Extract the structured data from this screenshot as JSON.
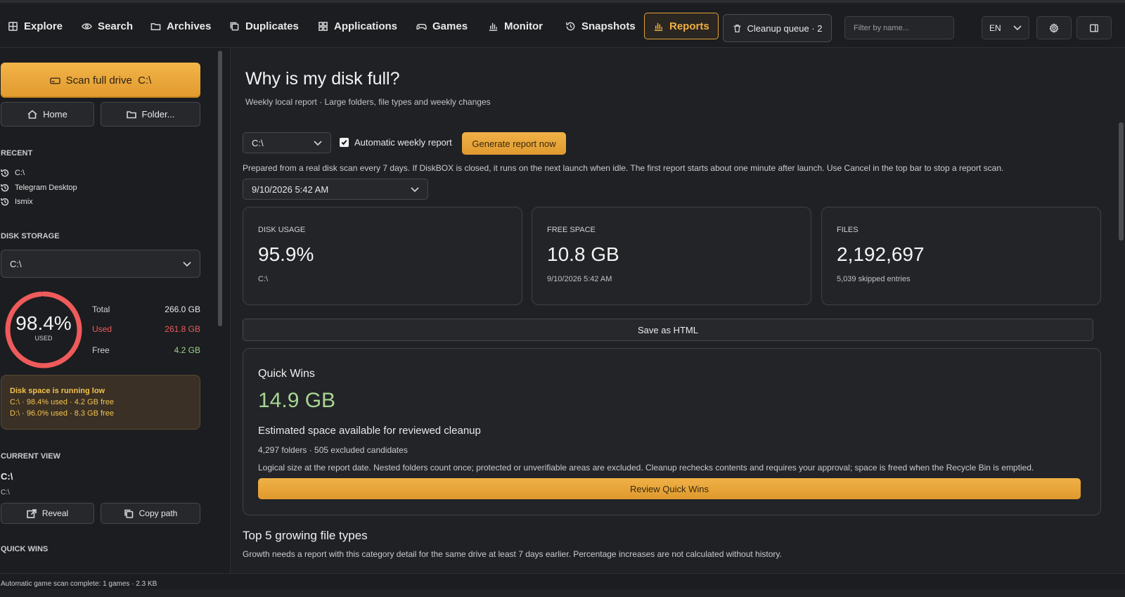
{
  "nav": {
    "items": [
      {
        "label": "Explore",
        "icon": "grid-icon"
      },
      {
        "label": "Search",
        "icon": "eye-icon"
      },
      {
        "label": "Archives",
        "icon": "folder-icon"
      },
      {
        "label": "Duplicates",
        "icon": "copy-icon"
      },
      {
        "label": "Applications",
        "icon": "apps-icon"
      },
      {
        "label": "Games",
        "icon": "gamepad-icon"
      },
      {
        "label": "Monitor",
        "icon": "bar-chart-icon"
      },
      {
        "label": "Snapshots",
        "icon": "history-icon"
      },
      {
        "label": "Reports",
        "icon": "report-chart-icon"
      }
    ],
    "active": "Reports",
    "cleanup_label": "Cleanup queue · 2",
    "filter_placeholder": "Filter by name...",
    "language": "EN"
  },
  "sidebar": {
    "scan_label": "Scan full drive  C:\\",
    "home_label": "Home",
    "folder_label": "Folder...",
    "recent_title": "RECENT",
    "recent": [
      "C:\\",
      "Telegram Desktop",
      "Ismix"
    ],
    "disk_storage_title": "DISK STORAGE",
    "drive": "C:\\",
    "usage_percent": "98.4%",
    "usage_fraction": 0.984,
    "usage_sub": "USED",
    "total_label": "Total",
    "total_value": "266.0 GB",
    "used_label": "Used",
    "used_value": "261.8 GB",
    "free_label": "Free",
    "free_value": "4.2 GB",
    "warning_title": "Disk space is running low",
    "warning_line1": "C:\\ · 98.4% used · 4.2 GB free",
    "warning_line2": "D:\\ · 96.0% used · 8.3 GB free",
    "current_view_title": "CURRENT VIEW",
    "current_view_name": "C:\\",
    "current_view_path": "C:\\",
    "reveal_label": "Reveal",
    "copy_path_label": "Copy path",
    "quick_wins_title": "QUICK WINS"
  },
  "main": {
    "title": "Why is my disk full?",
    "subtitle": "Weekly local report · Large folders, file types and weekly changes",
    "drive_select": "C:\\",
    "auto_weekly_label": "Automatic weekly report",
    "auto_weekly_checked": true,
    "generate_label": "Generate report now",
    "info": "Prepared from a real disk scan every 7 days. If DiskBOX is closed, it runs on the next launch when idle. The first report starts about one minute after launch. Use Cancel in the top bar to stop a report scan.",
    "report_date": "9/10/2026 5:42 AM",
    "cards": [
      {
        "label": "DISK USAGE",
        "value": "95.9%",
        "sub": "C:\\"
      },
      {
        "label": "FREE SPACE",
        "value": "10.8 GB",
        "sub": "9/10/2026 5:42 AM"
      },
      {
        "label": "FILES",
        "value": "2,192,697",
        "sub": "5,039 skipped entries"
      }
    ],
    "save_html_label": "Save as HTML",
    "quick_wins": {
      "title": "Quick Wins",
      "amount": "14.9 GB",
      "description": "Estimated space available for reviewed cleanup",
      "meta": "4,297 folders · 505 excluded candidates",
      "note": "Logical size at the report date. Nested folders count once; protected or unverifiable areas are excluded. Cleanup rechecks contents and requires your approval; space is freed when the Recycle Bin is emptied.",
      "button_label": "Review Quick Wins"
    },
    "growth_title": "Top 5 growing file types",
    "growth_sub": "Growth needs a report with this category detail for the same drive at least 7 days earlier. Percentage increases are not calculated without history."
  },
  "status": {
    "text": "Automatic game scan complete: 1 games · 2.3 KB"
  },
  "colors": {
    "accent": "#f2b043",
    "danger": "#ef5a5a",
    "success": "#a8d590",
    "background": "#1f2125"
  }
}
